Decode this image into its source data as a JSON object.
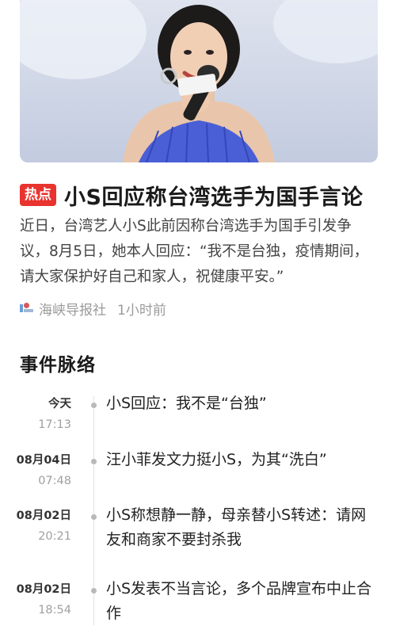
{
  "article": {
    "badge": "热点",
    "headline": "小S回应称台湾选手为国手言论",
    "summary": "近日，台湾艺人小S此前因称台湾选手为国手引发争议，8月5日，她本人回应：“我不是台独，疫情期间，请大家保护好自己和家人，祝健康平安。”",
    "source": "海峡导报社",
    "time_ago": "1小时前"
  },
  "timeline": {
    "title": "事件脉络",
    "events": [
      {
        "date": "今天",
        "time": "17:13",
        "text": "小S回应：我不是“台独”"
      },
      {
        "date": "08月04日",
        "time": "07:48",
        "text": "汪小菲发文力挺小S，为其“洗白”"
      },
      {
        "date": "08月02日",
        "time": "20:21",
        "text": "小S称想静一静，母亲替小S转述：请网友和商家不要封杀我"
      },
      {
        "date": "08月02日",
        "time": "18:54",
        "text": "小S发表不当言论，多个品牌宣布中止合作"
      }
    ]
  },
  "colors": {
    "badge": "#e8332e",
    "hero_bg": "#cfd6e6",
    "dress": "#4a5fd6"
  }
}
